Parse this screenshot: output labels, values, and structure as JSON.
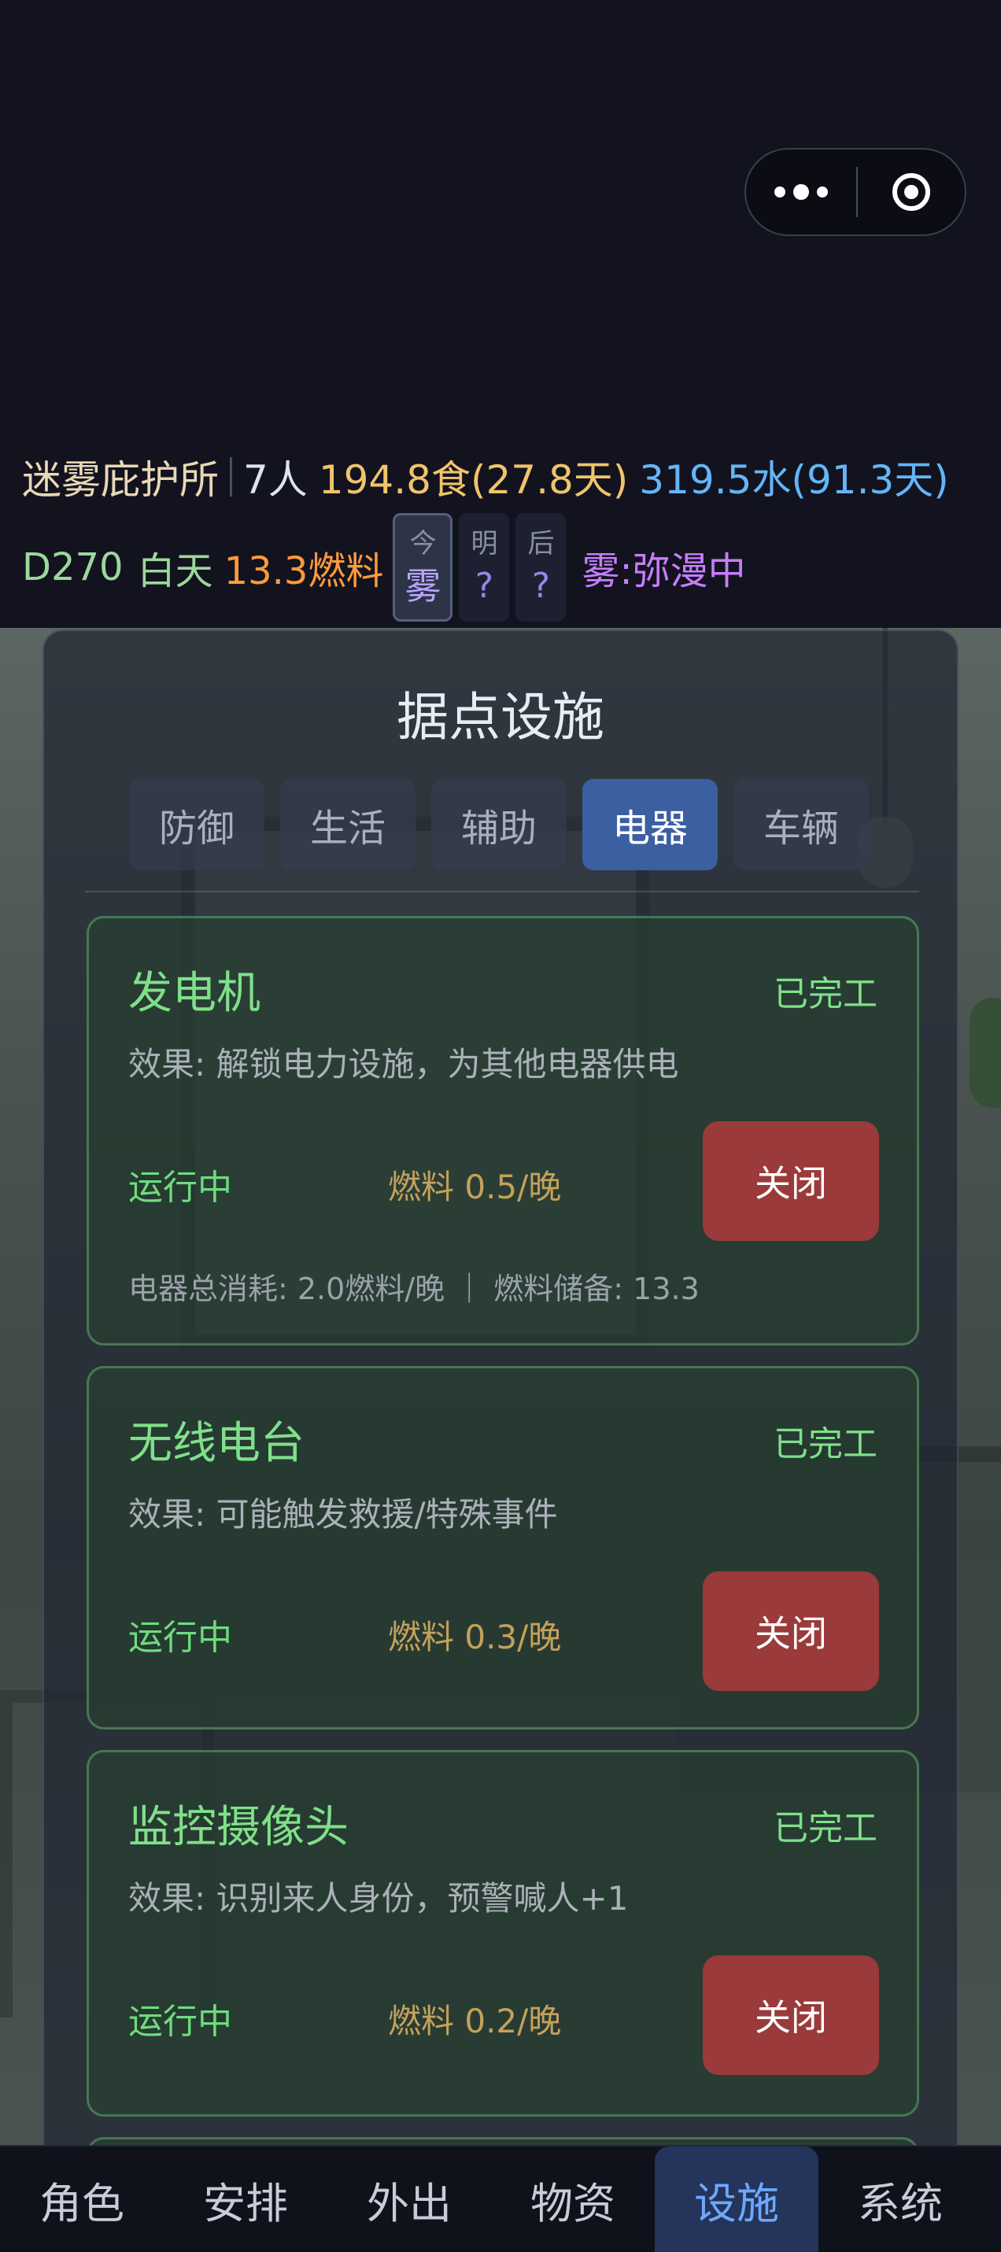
{
  "status": {
    "shelter_name": "迷雾庇护所",
    "people": "7人",
    "food": "194.8食(27.8天)",
    "water": "319.5水(91.3天)",
    "day": "D270",
    "period": "白天",
    "fuel": "13.3燃料",
    "weather": [
      {
        "day": "今",
        "value": "雾"
      },
      {
        "day": "明",
        "value": "?"
      },
      {
        "day": "后",
        "value": "?"
      }
    ],
    "fog_status": "雾:弥漫中"
  },
  "panel": {
    "title": "据点设施",
    "tabs": [
      "防御",
      "生活",
      "辅助",
      "电器",
      "车辆"
    ],
    "active_tab": "电器"
  },
  "facilities": [
    {
      "name": "发电机",
      "state": "已完工",
      "effect": "效果: 解锁电力设施，为其他电器供电",
      "running": "运行中",
      "fuel": "燃料 0.5/晚",
      "button": "关闭",
      "summary": "电器总消耗: 2.0燃料/晚 ｜ 燃料储备: 13.3"
    },
    {
      "name": "无线电台",
      "state": "已完工",
      "effect": "效果: 可能触发救援/特殊事件",
      "running": "运行中",
      "fuel": "燃料 0.3/晚",
      "button": "关闭"
    },
    {
      "name": "监控摄像头",
      "state": "已完工",
      "effect": "效果: 识别来人身份，预警喊人+1",
      "running": "运行中",
      "fuel": "燃料 0.2/晚",
      "button": "关闭"
    }
  ],
  "nav": {
    "items": [
      "角色",
      "安排",
      "外出",
      "物资",
      "设施",
      "系统"
    ],
    "active": "设施"
  },
  "colors": {
    "accent": "#3b5fa0",
    "running_green": "#6fdc7d",
    "close_red": "#9a3a3a",
    "food": "#f0c46a",
    "water": "#64b5f6",
    "fuel": "#ff9a3c",
    "fog": "#c77dff"
  }
}
